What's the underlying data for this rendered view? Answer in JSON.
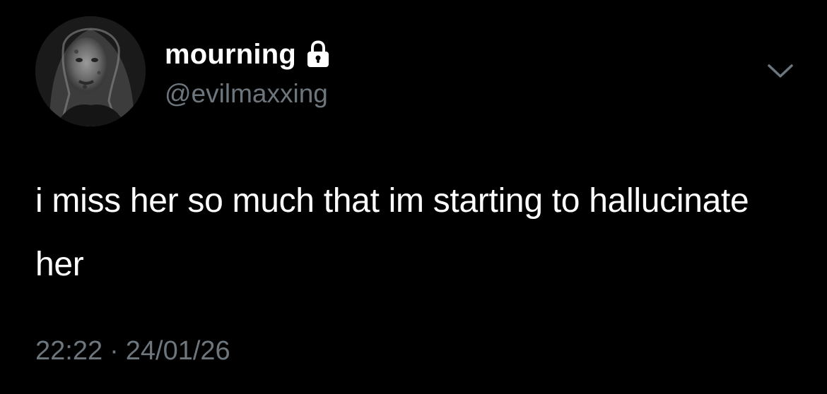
{
  "user": {
    "display_name": "mourning",
    "handle": "@evilmaxxing",
    "protected_icon": "lock-icon",
    "avatar": "profile-photo"
  },
  "tweet": {
    "text": "i miss her so much that im starting to hallucinate her",
    "time": "22:22",
    "separator": "·",
    "date": "24/01/26"
  },
  "menu": {
    "icon": "chevron-down-icon"
  },
  "colors": {
    "background": "#000000",
    "primary_text": "#ffffff",
    "secondary_text": "#6e767d"
  }
}
